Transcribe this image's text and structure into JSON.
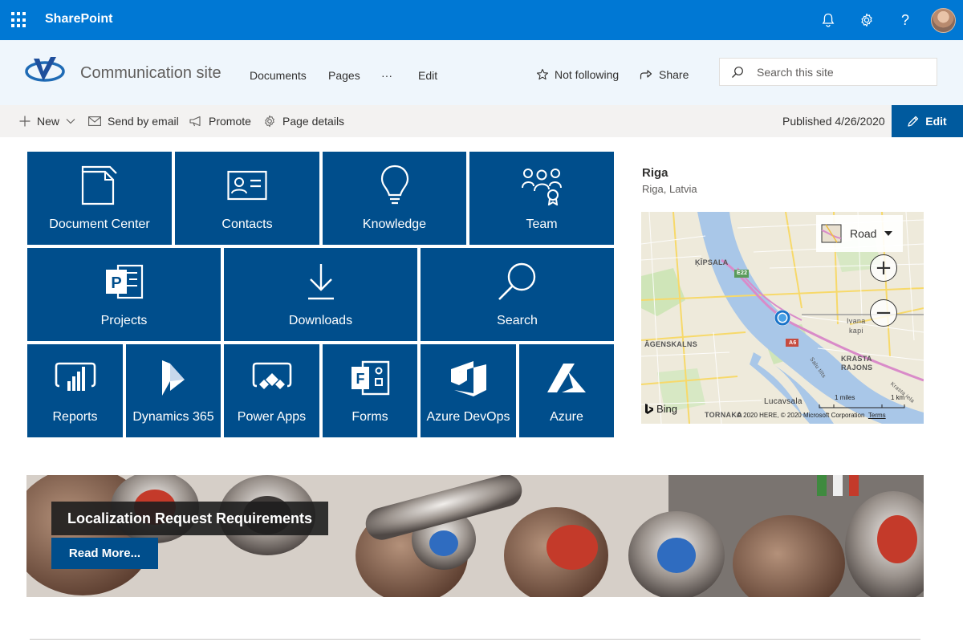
{
  "suite": {
    "app_name": "SharePoint",
    "icons": [
      "waffle-icon",
      "bell-icon",
      "gear-icon",
      "help-icon"
    ]
  },
  "site": {
    "title": "Communication site",
    "nav": [
      "Documents",
      "Pages",
      "···",
      "Edit"
    ],
    "follow_label": "Not following",
    "share_label": "Share",
    "search_placeholder": "Search this site"
  },
  "commandbar": {
    "new_label": "New",
    "send_label": "Send by email",
    "promote_label": "Promote",
    "details_label": "Page details",
    "published": "Published 4/26/2020",
    "edit_label": "Edit"
  },
  "tiles": {
    "row1": [
      "Document Center",
      "Contacts",
      "Knowledge",
      "Team"
    ],
    "row2": [
      "Projects",
      "Downloads",
      "Search"
    ],
    "row3": [
      "Reports",
      "Dynamics 365",
      "Power Apps",
      "Forms",
      "Azure DevOps",
      "Azure"
    ]
  },
  "map": {
    "title": "Riga",
    "subtitle": "Riga, Latvia",
    "style_label": "Road",
    "zoom_in": "+",
    "zoom_out": "−",
    "labels": {
      "kipsala": "ĶĪPSALA",
      "agenskalns": "ĀGENSKALNS",
      "ivana": "Ivana",
      "kapi": "kapi",
      "krasta": "KRASTA",
      "rajons": "RAJONS",
      "lucavsala": "Lucavsala",
      "tornakalns": "TORNAKA",
      "road_e22": "E22",
      "road_a6": "A6",
      "salu": "Salu tilts",
      "krasta_iela": "Krasta iela"
    },
    "bing": "Bing",
    "copyright": "© 2020 HERE, © 2020 Microsoft Corporation",
    "terms": "Terms",
    "scale_miles": "1 miles",
    "scale_km": "1 km"
  },
  "hero": {
    "title": "Localization Request Requirements",
    "button": "Read More..."
  },
  "colors": {
    "suite": "#0078d4",
    "tile": "#004e8c",
    "header": "#eff6fc"
  }
}
